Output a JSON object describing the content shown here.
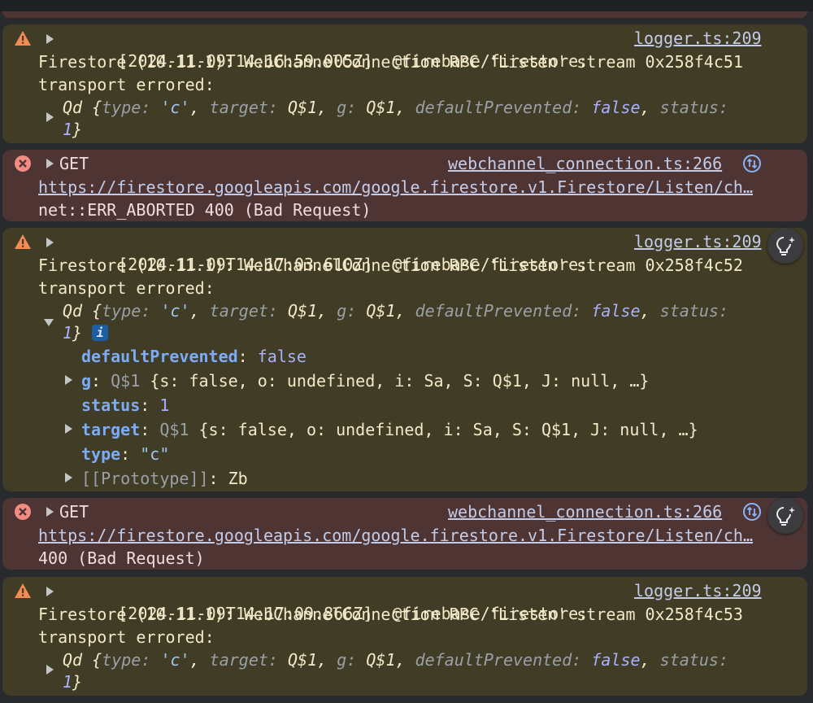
{
  "entries": [
    {
      "kind": "warning",
      "timestamp": "[2024-11-09T14:16:59.005Z]",
      "module": "@firebase/firestore:",
      "source": "logger.ts:209",
      "message_line1": "Firestore (10.11.1): WebChannelConnection RPC 'Listen' stream 0x258f4c51",
      "message_line2": "transport errored:",
      "obj": {
        "class": "Qd",
        "type_key": "type:",
        "type_val": "'c'",
        "target_key": "target:",
        "target_val": "Q$1",
        "g_key": "g:",
        "g_val": "Q$1",
        "dp_key": "defaultPrevented:",
        "dp_val": "false",
        "status_key": "status:",
        "status_val": "1"
      }
    },
    {
      "kind": "error",
      "method": "GET",
      "source": "webchannel_connection.ts:266",
      "url": "https://firestore.googleapis.com/google.firestore.v1.Firestore/Listen/ch…",
      "status_text": "net::ERR_ABORTED 400 (Bad Request)"
    },
    {
      "kind": "warning",
      "timestamp": "[2024-11-09T14:17:03.610Z]",
      "module": "@firebase/firestore:",
      "source": "logger.ts:209",
      "message_line1": "Firestore (10.11.1): WebChannelConnection RPC 'Listen' stream 0x258f4c52",
      "message_line2": "transport errored:",
      "obj": {
        "class": "Qd",
        "type_key": "type:",
        "type_val": "'c'",
        "target_key": "target:",
        "target_val": "Q$1",
        "g_key": "g:",
        "g_val": "Q$1",
        "dp_key": "defaultPrevented:",
        "dp_val": "false",
        "status_key": "status:",
        "status_val": "1",
        "info_badge": "i"
      },
      "expanded": [
        {
          "key": "defaultPrevented",
          "value": "false",
          "expandable": false
        },
        {
          "key": "g",
          "value": "Q$1",
          "summary": "{s: false, o: undefined, i: Sa, S: Q$1, J: null, …}",
          "expandable": true
        },
        {
          "key": "status",
          "value": "1",
          "expandable": false
        },
        {
          "key": "target",
          "value": "Q$1",
          "summary": "{s: false, o: undefined, i: Sa, S: Q$1, J: null, …}",
          "expandable": true
        },
        {
          "key": "type",
          "value": "\"c\"",
          "expandable": false
        },
        {
          "key": "[[Prototype]]",
          "value": "Zb",
          "expandable": true
        }
      ]
    },
    {
      "kind": "error",
      "method": "GET",
      "source": "webchannel_connection.ts:266",
      "url": "https://firestore.googleapis.com/google.firestore.v1.Firestore/Listen/ch…",
      "status_text": "400 (Bad Request)"
    },
    {
      "kind": "warning",
      "timestamp": "[2024-11-09T14:17:09.866Z]",
      "module": "@firebase/firestore:",
      "source": "logger.ts:209",
      "message_line1": "Firestore (10.11.1): WebChannelConnection RPC 'Listen' stream 0x258f4c53",
      "message_line2": "transport errored:",
      "obj": {
        "class": "Qd",
        "type_key": "type:",
        "type_val": "'c'",
        "target_key": "target:",
        "target_val": "Q$1",
        "g_key": "g:",
        "g_val": "Q$1",
        "dp_key": "defaultPrevented:",
        "dp_val": "false",
        "status_key": "status:",
        "status_val": "1"
      }
    }
  ],
  "colors": {
    "warning_bg": "#413c26",
    "error_bg": "#4e3534",
    "warning_icon": "#f28b54",
    "error_icon": "#f28b82"
  }
}
